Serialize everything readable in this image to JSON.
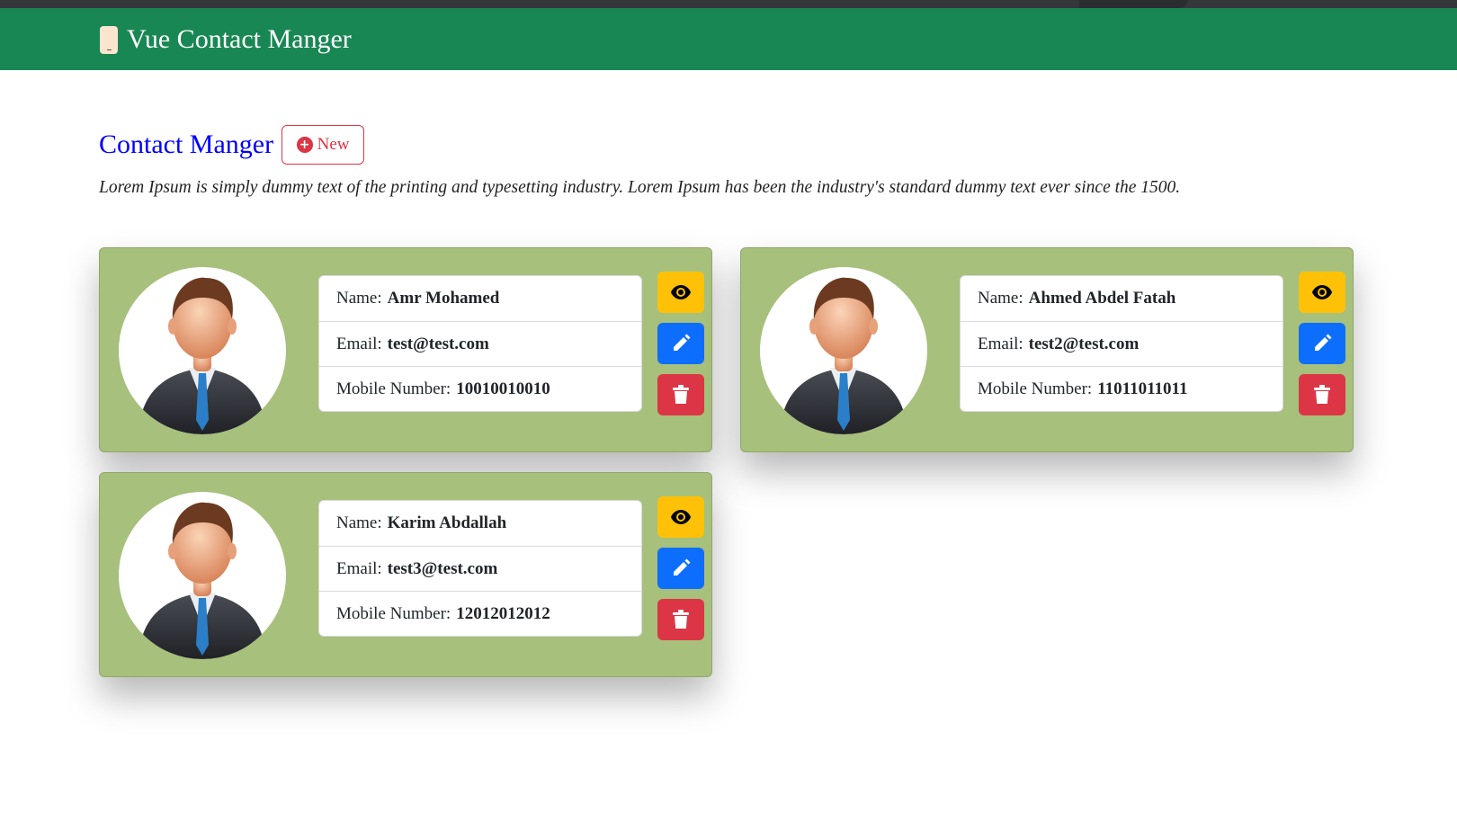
{
  "navbar": {
    "brand": "Vue Contact Manger",
    "brand_icon": "mobile-phone-icon"
  },
  "page": {
    "title": "Contact Manger",
    "new_button": "New",
    "description": "Lorem Ipsum is simply dummy text of the printing and typesetting industry. Lorem Ipsum has been the industry's standard dummy text ever since the 1500."
  },
  "labels": {
    "name": "Name:",
    "email": "Email:",
    "mobile": "Mobile Number:"
  },
  "contacts": [
    {
      "name": "Amr Mohamed",
      "email": "test@test.com",
      "mobile": "10010010010"
    },
    {
      "name": "Ahmed Abdel Fatah",
      "email": "test2@test.com",
      "mobile": "11011011011"
    },
    {
      "name": "Karim Abdallah",
      "email": "test3@test.com",
      "mobile": "12012012012"
    }
  ],
  "colors": {
    "navbar": "#198754",
    "card": "#a7c07c",
    "title": "#0000ff",
    "view": "#ffc107",
    "edit": "#0d6efd",
    "delete": "#dc3545"
  }
}
